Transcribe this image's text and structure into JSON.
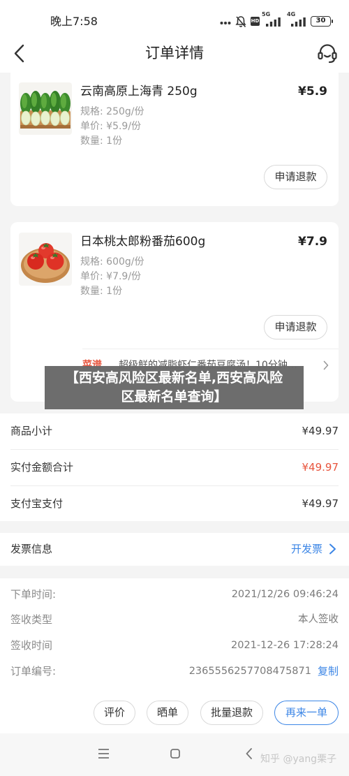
{
  "status_bar": {
    "time": "晚上7:58",
    "hd_label": "HD",
    "net1_label": "5G",
    "net2_label": "4G",
    "battery_level": "30",
    "icons": [
      "more-dots-icon",
      "mute-icon",
      "hd-icon",
      "signal-5g-icon",
      "signal-4g-icon",
      "battery-icon"
    ]
  },
  "header": {
    "title": "订单详情",
    "icons": [
      "chevron-left-icon",
      "headset-icon"
    ]
  },
  "products": [
    {
      "name": "云南高原上海青 250g",
      "price": "¥5.9",
      "spec": "规格: 250g/份",
      "unit_price": "单价: ¥5.9/份",
      "quantity": "数量: 1份",
      "refund_label": "申请退款",
      "image_icon": "bok-choy-image"
    },
    {
      "name": "日本桃太郎粉番茄600g",
      "price": "¥7.9",
      "spec": "规格: 600g/份",
      "unit_price": "单价: ¥7.9/份",
      "quantity": "数量: 1份",
      "refund_label": "申请退款",
      "image_icon": "tomato-image",
      "recipe": {
        "badge": "菜谱",
        "text": "超级鲜的减脂虾仁番茄豆腐汤！10分钟…"
      }
    }
  ],
  "overlay_banner": {
    "line1": "【西安高风险区最新名单,西安高风险",
    "line2": "区最新名单查询】"
  },
  "summary": [
    {
      "label": "商品小计",
      "value": "¥49.97"
    },
    {
      "label": "实付金额合计",
      "value": "¥49.97"
    },
    {
      "label": "支付宝支付",
      "value": "¥49.97"
    }
  ],
  "invoice": {
    "label": "发票信息",
    "action": "开发票"
  },
  "order_info": {
    "rows": [
      {
        "label": "下单时间:",
        "value": "2021/12/26 09:46:24"
      },
      {
        "label": "签收类型",
        "value": "本人签收"
      },
      {
        "label": "签收时间",
        "value": "2021-12-26 17:28:24"
      },
      {
        "label": "订单编号:",
        "value": "2365556257708475871"
      }
    ],
    "copy_label": "复制"
  },
  "actions": {
    "review": "评价",
    "share": "晒单",
    "batch_refund": "批量退款",
    "reorder": "再来一单"
  },
  "navbar": {
    "icons": [
      "menu-icon",
      "home-icon",
      "back-icon"
    ],
    "watermark": "知乎 @yang栗子"
  },
  "colors": {
    "accent_blue": "#3c86e6",
    "price_red": "#e8553e",
    "page_bg": "#f4f4f4"
  }
}
